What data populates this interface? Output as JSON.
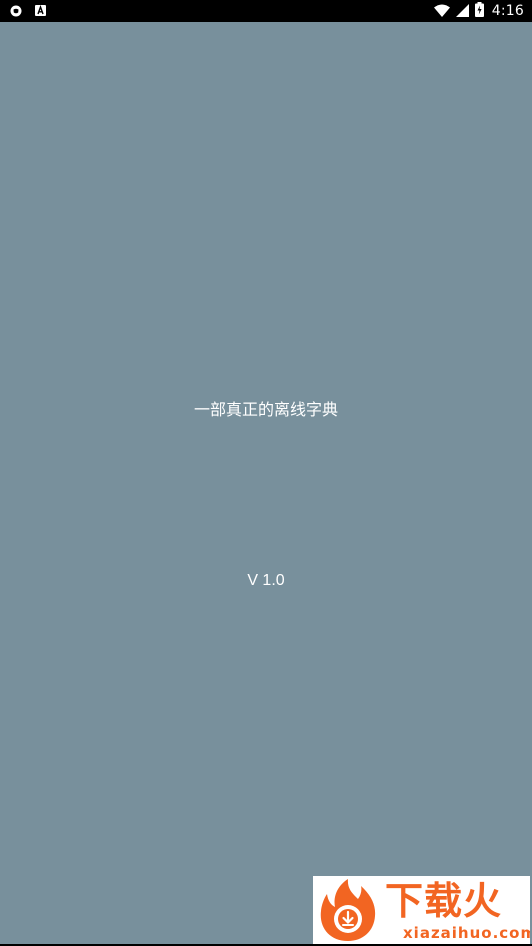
{
  "status_bar": {
    "time": "4:16",
    "battery_level": 0.6,
    "icons": [
      "shield-notification-icon",
      "a-notification-icon",
      "wifi-icon",
      "cell-signal-icon",
      "battery-charging-icon"
    ]
  },
  "splash": {
    "slogan": "一部真正的离线字典",
    "version": "V 1.0",
    "background_color": "#78909c"
  },
  "watermark": {
    "title": "下载火",
    "domain": "xiazaihuo.com",
    "brand_color": "#f26522"
  }
}
